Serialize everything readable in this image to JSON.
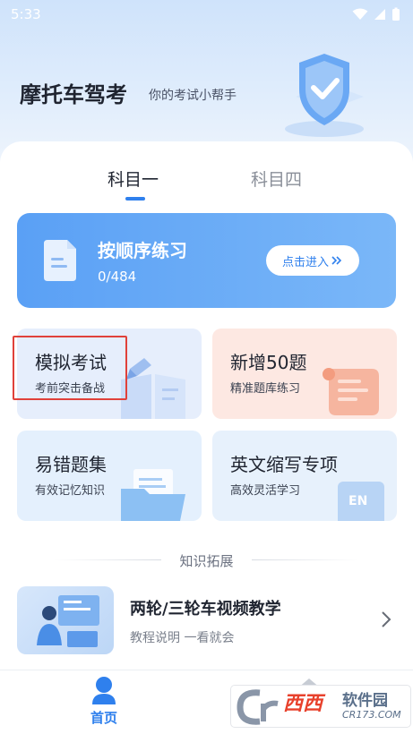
{
  "status_bar": {
    "time": "5:33"
  },
  "header": {
    "title": "摩托车驾考",
    "subtitle": "你的考试小帮手"
  },
  "tabs": [
    {
      "label": "科目一",
      "active": true
    },
    {
      "label": "科目四",
      "active": false
    }
  ],
  "practice": {
    "title": "按顺序练习",
    "progress": "0/484",
    "enter_label": "点击进入"
  },
  "modules": [
    {
      "title": "模拟考试",
      "subtitle": "考前突击备战",
      "icon": "book-pencil-icon"
    },
    {
      "title": "新增50题",
      "subtitle": "精准题库练习",
      "icon": "scroll-icon"
    },
    {
      "title": "易错题集",
      "subtitle": "有效记忆知识",
      "icon": "folder-icon"
    },
    {
      "title": "英文缩写专项",
      "subtitle": "高效灵活学习",
      "icon": "en-card-icon",
      "badge": "EN"
    }
  ],
  "knowledge": {
    "section_title": "知识拓展",
    "video": {
      "title": "两轮/三轮车视频教学",
      "subtitle": "教程说明 一看就会"
    }
  },
  "bottom_nav": {
    "home_label": "首页"
  },
  "watermark": {
    "brand": "西西",
    "name": "软件园",
    "url": "CR173.COM"
  },
  "colors": {
    "accent": "#2f80ed",
    "highlight": "#e0413a"
  }
}
